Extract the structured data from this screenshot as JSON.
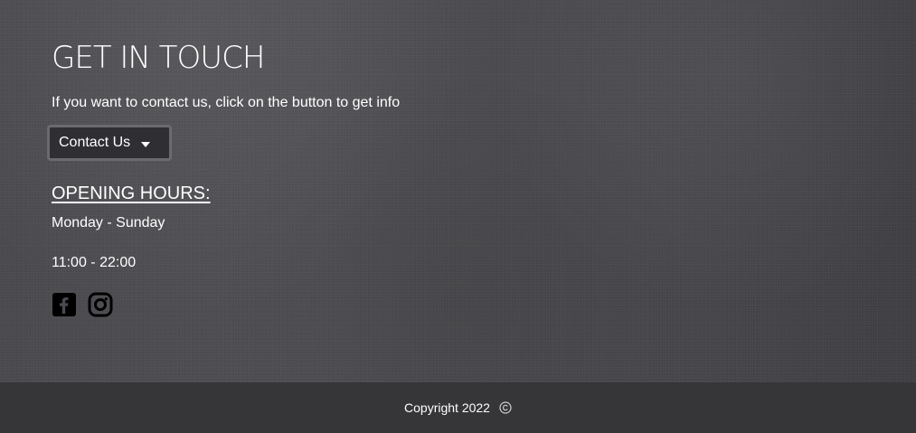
{
  "section": {
    "title": "GET IN TOUCH",
    "lead": "If you want to contact us, click on the button to get info"
  },
  "contact_button": {
    "label": "Contact Us",
    "icon": "caret-down-icon"
  },
  "hours": {
    "title": "OPENING HOURS:",
    "days": "Monday - Sunday",
    "time": "11:00 - 22:00"
  },
  "social": {
    "facebook_icon": "facebook-icon",
    "instagram_icon": "instagram-icon"
  },
  "footer": {
    "copyright": "Copyright 2022",
    "icon": "copyright-icon"
  },
  "colors": {
    "background": "#4b4b4f",
    "footer": "#363639",
    "button": "#2f2f33",
    "text": "#ffffff"
  }
}
